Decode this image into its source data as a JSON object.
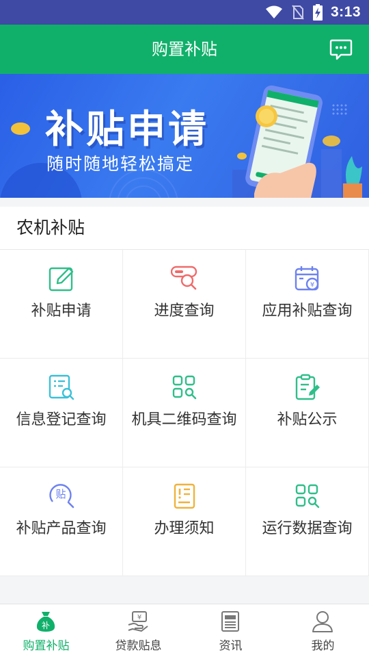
{
  "status_bar": {
    "time": "3:13"
  },
  "header": {
    "title": "购置补贴",
    "message_icon": "message-bubble-icon"
  },
  "banner": {
    "headline": "补贴申请",
    "subtitle": "随时随地轻松搞定"
  },
  "section": {
    "title": "农机补贴",
    "items": [
      {
        "label": "补贴申请",
        "icon": "edit-icon",
        "color": "#2fbe8a"
      },
      {
        "label": "进度查询",
        "icon": "progress-search-icon",
        "color": "#f06a6a"
      },
      {
        "label": "应用补贴查询",
        "icon": "calendar-yen-icon",
        "color": "#6d82f0"
      },
      {
        "label": "信息登记查询",
        "icon": "document-search-icon",
        "color": "#3cc0d8"
      },
      {
        "label": "机具二维码查询",
        "icon": "qrcode-search-icon",
        "color": "#2fbe8a"
      },
      {
        "label": "补贴公示",
        "icon": "clipboard-edit-icon",
        "color": "#2fbe8a"
      },
      {
        "label": "补贴产品查询",
        "icon": "subsidy-search-icon",
        "color": "#6d82f0"
      },
      {
        "label": "办理须知",
        "icon": "notice-icon",
        "color": "#f0b23a"
      },
      {
        "label": "运行数据查询",
        "icon": "grid-search-icon",
        "color": "#2fbe8a"
      }
    ]
  },
  "bottom_nav": {
    "items": [
      {
        "label": "购置补贴",
        "icon": "money-bag-icon",
        "active": true,
        "icon_text": "补"
      },
      {
        "label": "贷款贴息",
        "icon": "hand-coin-icon",
        "active": false
      },
      {
        "label": "资讯",
        "icon": "newspaper-icon",
        "active": false
      },
      {
        "label": "我的",
        "icon": "user-icon",
        "active": false
      }
    ]
  },
  "colors": {
    "brand_green": "#10b06a",
    "status_bar": "#3f4aa4",
    "banner_blue": "#2f66e8"
  }
}
